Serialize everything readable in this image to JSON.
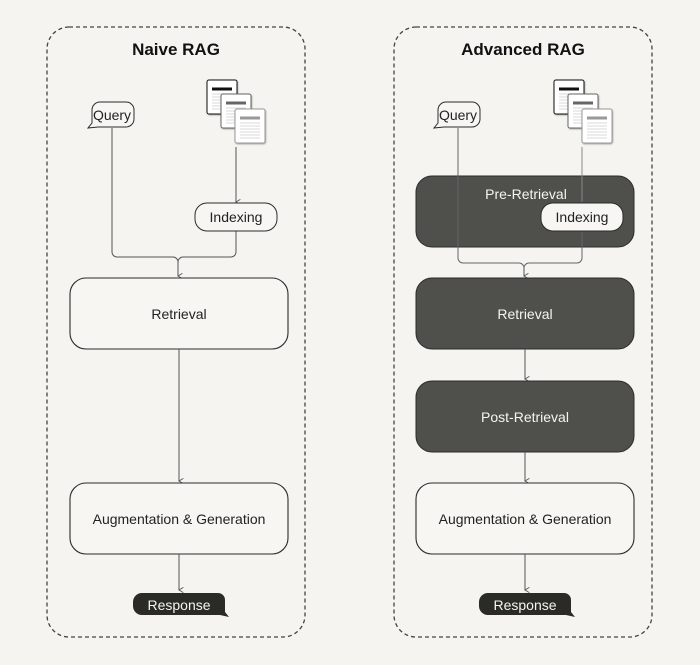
{
  "colors": {
    "background": "#f5f4f0",
    "box_light_fill": "#f7f6f2",
    "box_dark_fill": "#4f4f4b",
    "stroke": "#2b2b2b",
    "response_fill": "#2a2a27"
  },
  "panels": [
    {
      "title": "Naive RAG",
      "query_label": "Query",
      "documents_icon": "documents-icon",
      "indexing_label": "Indexing",
      "retrieval_label": "Retrieval",
      "augmentation_label": "Augmentation & Generation",
      "response_label": "Response"
    },
    {
      "title": "Advanced RAG",
      "query_label": "Query",
      "documents_icon": "documents-icon",
      "pre_retrieval_label": "Pre-Retrieval",
      "indexing_label": "Indexing",
      "retrieval_label": "Retrieval",
      "post_retrieval_label": "Post-Retrieval",
      "augmentation_label": "Augmentation & Generation",
      "response_label": "Response"
    }
  ]
}
